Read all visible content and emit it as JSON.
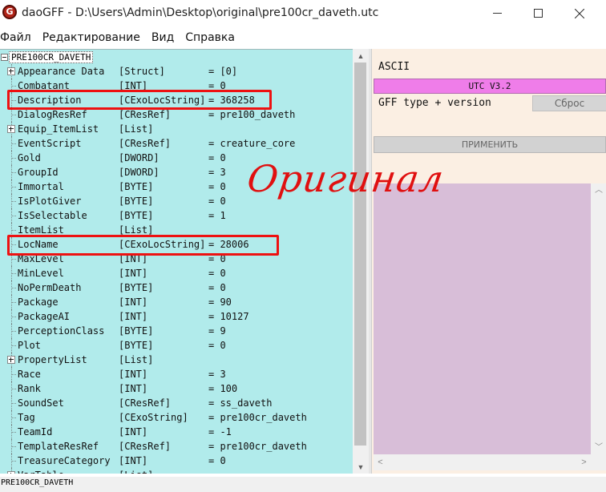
{
  "window": {
    "app_icon_letter": "G",
    "title": "daoGFF - D:\\Users\\Admin\\Desktop\\original\\pre100cr_daveth.utc"
  },
  "menu": [
    "Файл",
    "Редактирование",
    "Вид",
    "Справка"
  ],
  "tree": {
    "root": "PRE100CR_DAVETH",
    "rows": [
      {
        "name": "Appearance Data",
        "type": "[Struct]",
        "value": "= [0]",
        "expandable": true
      },
      {
        "name": "Combatant",
        "type": "[INT]",
        "value": "= 0",
        "expandable": false
      },
      {
        "name": "Description",
        "type": "[CExoLocString]",
        "value": "= 368258",
        "expandable": false
      },
      {
        "name": "DialogResRef",
        "type": "[CResRef]",
        "value": "= pre100_daveth",
        "expandable": false
      },
      {
        "name": "Equip_ItemList",
        "type": "[List]",
        "value": "",
        "expandable": true
      },
      {
        "name": "EventScript",
        "type": "[CResRef]",
        "value": "= creature_core",
        "expandable": false
      },
      {
        "name": "Gold",
        "type": "[DWORD]",
        "value": "= 0",
        "expandable": false
      },
      {
        "name": "GroupId",
        "type": "[DWORD]",
        "value": "= 3",
        "expandable": false
      },
      {
        "name": "Immortal",
        "type": "[BYTE]",
        "value": "= 0",
        "expandable": false
      },
      {
        "name": "IsPlotGiver",
        "type": "[BYTE]",
        "value": "= 0",
        "expandable": false
      },
      {
        "name": "IsSelectable",
        "type": "[BYTE]",
        "value": "= 1",
        "expandable": false
      },
      {
        "name": "ItemList",
        "type": "[List]",
        "value": "",
        "expandable": false
      },
      {
        "name": "LocName",
        "type": "[CExoLocString]",
        "value": "= 28006",
        "expandable": false
      },
      {
        "name": "MaxLevel",
        "type": "[INT]",
        "value": "= 0",
        "expandable": false
      },
      {
        "name": "MinLevel",
        "type": "[INT]",
        "value": "= 0",
        "expandable": false
      },
      {
        "name": "NoPermDeath",
        "type": "[BYTE]",
        "value": "= 0",
        "expandable": false
      },
      {
        "name": "Package",
        "type": "[INT]",
        "value": "= 90",
        "expandable": false
      },
      {
        "name": "PackageAI",
        "type": "[INT]",
        "value": "= 10127",
        "expandable": false
      },
      {
        "name": "PerceptionClass",
        "type": "[BYTE]",
        "value": "= 9",
        "expandable": false
      },
      {
        "name": "Plot",
        "type": "[BYTE]",
        "value": "= 0",
        "expandable": false
      },
      {
        "name": "PropertyList",
        "type": "[List]",
        "value": "",
        "expandable": true
      },
      {
        "name": "Race",
        "type": "[INT]",
        "value": "= 3",
        "expandable": false
      },
      {
        "name": "Rank",
        "type": "[INT]",
        "value": "= 100",
        "expandable": false
      },
      {
        "name": "SoundSet",
        "type": "[CResRef]",
        "value": "= ss_daveth",
        "expandable": false
      },
      {
        "name": "Tag",
        "type": "[CExoString]",
        "value": "= pre100cr_daveth",
        "expandable": false
      },
      {
        "name": "TeamId",
        "type": "[INT]",
        "value": "= -1",
        "expandable": false
      },
      {
        "name": "TemplateResRef",
        "type": "[CResRef]",
        "value": "= pre100cr_daveth",
        "expandable": false
      },
      {
        "name": "TreasureCategory",
        "type": "[INT]",
        "value": "= 0",
        "expandable": false
      },
      {
        "name": "VarTable",
        "type": "[List]",
        "value": "",
        "expandable": true
      }
    ],
    "highlighted_rows": [
      "Description",
      "LocName"
    ]
  },
  "status_bar": "PRE100CR_DAVETH",
  "right_panel": {
    "encoding_label": "ASCII",
    "version_label": "UTC V3.2",
    "gff_label": "GFF type + version",
    "reset_button": "Сброс",
    "apply_button": "ПРИМЕНИТЬ"
  },
  "watermark": "Оригинал",
  "colors": {
    "tree_background": "#b1ebeb",
    "highlight_box": "#ee1111",
    "version_bar": "#ef7de9",
    "text_area": "#d8bed8",
    "right_panel_background": "#fbefe3",
    "watermark": "#e01010"
  }
}
